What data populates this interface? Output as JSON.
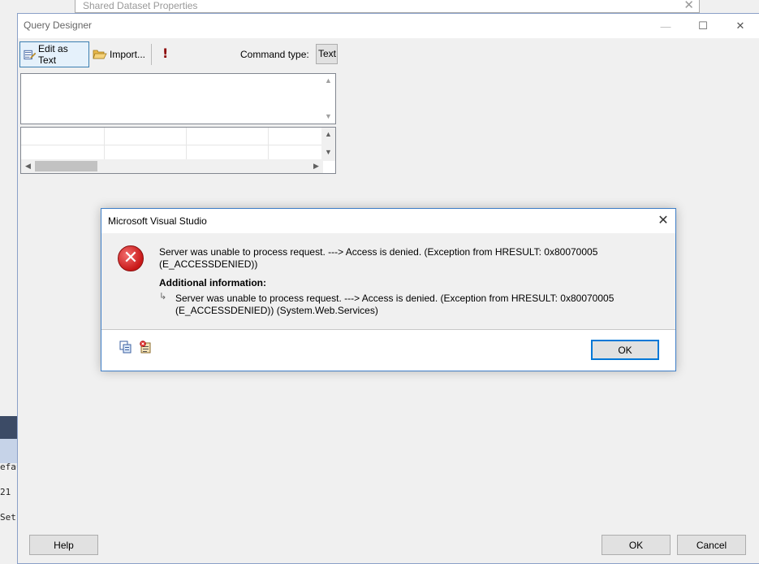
{
  "background_window": {
    "title": "Shared Dataset Properties",
    "close_glyph": "✕",
    "left_strip_lines": [
      "efau",
      "21",
      "Set"
    ]
  },
  "query_designer": {
    "title": "Query Designer",
    "window_controls": {
      "minimize": "—",
      "maximize": "☐",
      "close": "✕"
    },
    "toolbar": {
      "edit_as_text_label": "Edit as Text",
      "import_label": "Import...",
      "run_glyph": "!",
      "command_type_label": "Command type:",
      "command_type_value": "Text"
    },
    "query_text": "",
    "buttons": {
      "help": "Help",
      "ok": "OK",
      "cancel": "Cancel"
    }
  },
  "error_dialog": {
    "title": "Microsoft Visual Studio",
    "close_glyph": "✕",
    "message_line1": "Server was unable to process request. ---> Access is denied. (Exception from HRESULT: 0x80070005",
    "message_line2": "(E_ACCESSDENIED))",
    "additional_heading": "Additional information:",
    "additional_line1": "Server was unable to process request. ---> Access is denied. (Exception from HRESULT: 0x80070005",
    "additional_line2": "(E_ACCESSDENIED)) (System.Web.Services)",
    "ok_label": "OK"
  },
  "colors": {
    "accent": "#0078d7",
    "error_red": "#c81818",
    "window_border": "#3e7ec7"
  }
}
